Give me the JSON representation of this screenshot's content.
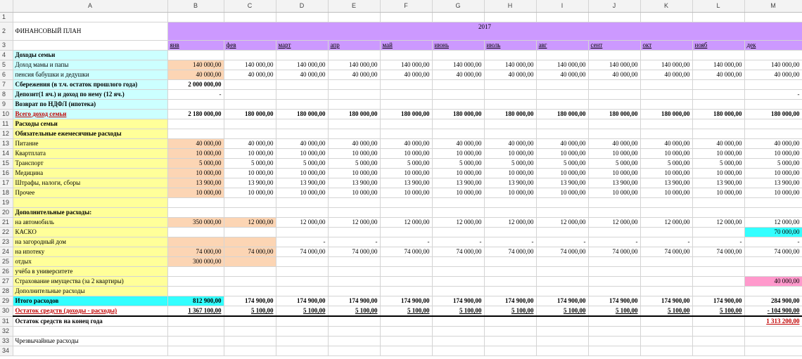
{
  "columns": [
    "A",
    "B",
    "C",
    "D",
    "E",
    "F",
    "G",
    "H",
    "I",
    "J",
    "K",
    "L",
    "M"
  ],
  "title": "ФИНАНСОВЫЙ ПЛАН",
  "year": "2017",
  "months": [
    "янв",
    "фев",
    "март",
    "апр",
    "май",
    "июнь",
    "июль",
    "авг",
    "сент",
    "окт",
    "нояб",
    "дек"
  ],
  "rows": [
    {
      "n": "1",
      "label": "",
      "values": []
    },
    {
      "n": "2",
      "label": "ФИНАНСОВЫЙ ПЛАН",
      "values": []
    },
    {
      "n": "3",
      "label": "",
      "values": []
    },
    {
      "n": "4",
      "label": "Доходы семьи",
      "values": []
    },
    {
      "n": "5",
      "label": "Доход мамы и папы",
      "values": [
        "140 000,00",
        "140 000,00",
        "140 000,00",
        "140 000,00",
        "140 000,00",
        "140 000,00",
        "140 000,00",
        "140 000,00",
        "140 000,00",
        "140 000,00",
        "140 000,00",
        "140 000,00"
      ]
    },
    {
      "n": "6",
      "label": "пенсия бабушки и дедушки",
      "values": [
        "40 000,00",
        "40 000,00",
        "40 000,00",
        "40 000,00",
        "40 000,00",
        "40 000,00",
        "40 000,00",
        "40 000,00",
        "40 000,00",
        "40 000,00",
        "40 000,00",
        "40 000,00"
      ]
    },
    {
      "n": "7",
      "label": "Сбережения (в т.ч. остаток  прошлого года)",
      "values": [
        "2 000 000,00"
      ]
    },
    {
      "n": "8",
      "label": "Депозит(1 яч.) и доход по нему (12 яч.)",
      "values": [
        "-",
        "",
        "",
        "",
        "",
        "",
        "",
        "",
        "",
        "",
        "",
        "-"
      ]
    },
    {
      "n": "9",
      "label": "Возврат по НДФЛ (ипотека)",
      "values": []
    },
    {
      "n": "10",
      "label": "Всего доход семьи",
      "values": [
        "2 180 000,00",
        "180 000,00",
        "180 000,00",
        "180 000,00",
        "180 000,00",
        "180 000,00",
        "180 000,00",
        "180 000,00",
        "180 000,00",
        "180 000,00",
        "180 000,00",
        "180 000,00"
      ]
    },
    {
      "n": "11",
      "label": "Расходы семьи",
      "values": []
    },
    {
      "n": "12",
      "label": "Обязательные ежемесячные расходы",
      "values": []
    },
    {
      "n": "13",
      "label": "Питание",
      "values": [
        "40 000,00",
        "40 000,00",
        "40 000,00",
        "40 000,00",
        "40 000,00",
        "40 000,00",
        "40 000,00",
        "40 000,00",
        "40 000,00",
        "40 000,00",
        "40 000,00",
        "40 000,00"
      ]
    },
    {
      "n": "14",
      "label": "Квартплата",
      "values": [
        "10 000,00",
        "10 000,00",
        "10 000,00",
        "10 000,00",
        "10 000,00",
        "10 000,00",
        "10 000,00",
        "10 000,00",
        "10 000,00",
        "10 000,00",
        "10 000,00",
        "10 000,00"
      ]
    },
    {
      "n": "15",
      "label": "Транспорт",
      "values": [
        "5 000,00",
        "5 000,00",
        "5 000,00",
        "5 000,00",
        "5 000,00",
        "5 000,00",
        "5 000,00",
        "5 000,00",
        "5 000,00",
        "5 000,00",
        "5 000,00",
        "5 000,00"
      ]
    },
    {
      "n": "16",
      "label": "Медицина",
      "values": [
        "10 000,00",
        "10 000,00",
        "10 000,00",
        "10 000,00",
        "10 000,00",
        "10 000,00",
        "10 000,00",
        "10 000,00",
        "10 000,00",
        "10 000,00",
        "10 000,00",
        "10 000,00"
      ]
    },
    {
      "n": "17",
      "label": "Штрафы, налоги, сборы",
      "values": [
        "13 900,00",
        "13 900,00",
        "13 900,00",
        "13 900,00",
        "13 900,00",
        "13 900,00",
        "13 900,00",
        "13 900,00",
        "13 900,00",
        "13 900,00",
        "13 900,00",
        "13 900,00"
      ]
    },
    {
      "n": "18",
      "label": "Прочее",
      "values": [
        "10 000,00",
        "10 000,00",
        "10 000,00",
        "10 000,00",
        "10 000,00",
        "10 000,00",
        "10 000,00",
        "10 000,00",
        "10 000,00",
        "10 000,00",
        "10 000,00",
        "10 000,00"
      ]
    },
    {
      "n": "19",
      "label": "",
      "values": []
    },
    {
      "n": "20",
      "label": "Дополнительные расходы:",
      "values": []
    },
    {
      "n": "21",
      "label": "на автомобиль",
      "values": [
        "350 000,00",
        "12 000,00",
        "12 000,00",
        "12 000,00",
        "12 000,00",
        "12 000,00",
        "12 000,00",
        "12 000,00",
        "12 000,00",
        "12 000,00",
        "12 000,00",
        "12 000,00"
      ]
    },
    {
      "n": "22",
      "label": "КАСКО",
      "values": [
        "",
        "",
        "",
        "",
        "",
        "",
        "",
        "",
        "",
        "",
        "",
        "70 000,00"
      ]
    },
    {
      "n": "23",
      "label": "на загородный дом",
      "values": [
        "",
        "",
        "-",
        "-",
        "-",
        "-",
        "-",
        "-",
        "-",
        "-",
        "-",
        "-"
      ]
    },
    {
      "n": "24",
      "label": "на ипотеку",
      "values": [
        "74 000,00",
        "74 000,00",
        "74 000,00",
        "74 000,00",
        "74 000,00",
        "74 000,00",
        "74 000,00",
        "74 000,00",
        "74 000,00",
        "74 000,00",
        "74 000,00",
        "74 000,00"
      ]
    },
    {
      "n": "25",
      "label": "отдых",
      "values": [
        "300 000,00"
      ]
    },
    {
      "n": "26",
      "label": "учёба в университете",
      "values": []
    },
    {
      "n": "27",
      "label": "Страхование имущества (за 2 квартиры)",
      "values": [
        "",
        "",
        "",
        "",
        "",
        "",
        "",
        "",
        "",
        "",
        "",
        "40 000,00"
      ]
    },
    {
      "n": "28",
      "label": "Дополнительные расходы",
      "values": []
    },
    {
      "n": "29",
      "label": "Итого расходов",
      "values": [
        "812 900,00",
        "174 900,00",
        "174 900,00",
        "174 900,00",
        "174 900,00",
        "174 900,00",
        "174 900,00",
        "174 900,00",
        "174 900,00",
        "174 900,00",
        "174 900,00",
        "284 900,00"
      ]
    },
    {
      "n": "30",
      "label": "Остаток средств (доходы - расходы)",
      "values": [
        "1 367 100,00",
        "5 100,00",
        "5 100,00",
        "5 100,00",
        "5 100,00",
        "5 100,00",
        "5 100,00",
        "5 100,00",
        "5 100,00",
        "5 100,00",
        "5 100,00",
        "-    104 900,00"
      ]
    },
    {
      "n": "31",
      "label": "Остаток средств на конец года",
      "values": [
        "",
        "",
        "",
        "",
        "",
        "",
        "",
        "",
        "",
        "",
        "",
        "1 313 200,00"
      ]
    },
    {
      "n": "32",
      "label": "",
      "values": []
    },
    {
      "n": "33",
      "label": "Чрезвычайные расходы",
      "values": []
    },
    {
      "n": "34",
      "label": "",
      "values": []
    }
  ],
  "colors": {
    "income_fill": "#ccffff",
    "expense_fill": "#ffff99",
    "input_fill": "#fcd5b4",
    "year_fill": "#cc99ff",
    "total_fill": "#33ffff",
    "insurance_fill": "#ff99cc",
    "negative_text": "#c00000"
  }
}
